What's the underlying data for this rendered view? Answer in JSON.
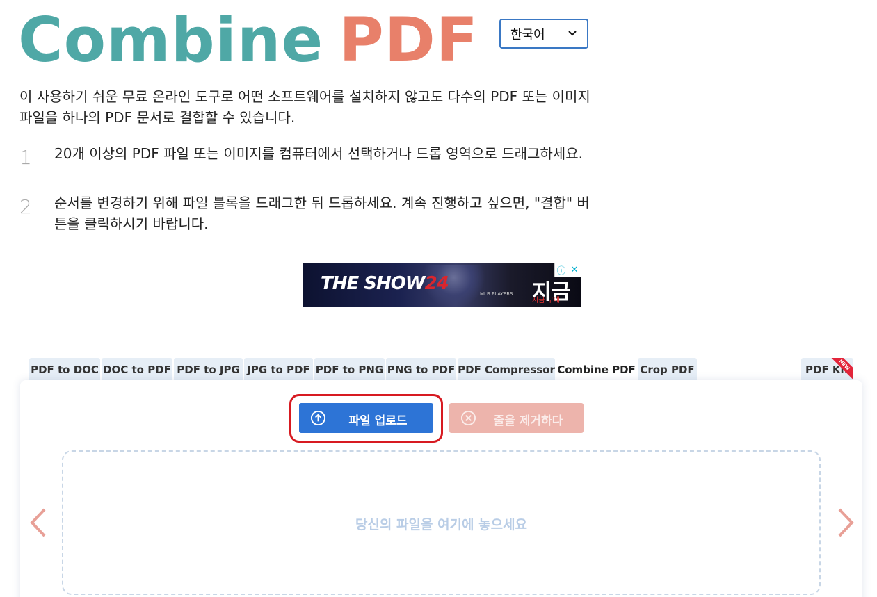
{
  "logo": {
    "part1": "Combine",
    "part2": "PDF"
  },
  "language": {
    "selected": "한국어"
  },
  "intro": "이 사용하기 쉬운 무료 온라인 도구로 어떤 소프트웨어를 설치하지 않고도 다수의 PDF 또는 이미지 파일을 하나의 PDF 문서로 결합할 수 있습니다.",
  "steps": [
    {
      "num": "1",
      "text": "20개 이상의 PDF 파일 또는 이미지를 컴퓨터에서 선택하거나 드롭 영역으로 드래그하세요."
    },
    {
      "num": "2",
      "text": "순서를 변경하기 위해 파일 블록을 드래그한 뒤 드롭하세요. 계속 진행하고 싶으면, \"결합\" 버튼을 클릭하시기 바랍니다."
    }
  ],
  "ad": {
    "title_pre": "THE SHOW",
    "title_num": "24",
    "cta": "지금",
    "sub": "지금 구매",
    "brand": "MLB PLAYERS"
  },
  "tabs": [
    {
      "label": "PDF to DOC"
    },
    {
      "label": "DOC to PDF"
    },
    {
      "label": "PDF to JPG"
    },
    {
      "label": "JPG to PDF"
    },
    {
      "label": "PDF to PNG"
    },
    {
      "label": "PNG to PDF"
    },
    {
      "label": "PDF Compressor"
    },
    {
      "label": "Combine PDF"
    },
    {
      "label": "Crop PDF"
    }
  ],
  "active_tab": "Combine PDF",
  "kit": {
    "label": "PDF Kit",
    "badge": "NEW"
  },
  "buttons": {
    "upload": "파일 업로드",
    "remove": "줄을 제거하다"
  },
  "dropzone": {
    "text": "당신의 파일을 여기에 놓으세요"
  },
  "colors": {
    "logo_teal": "#4fa8a6",
    "logo_coral": "#e8806a",
    "upload_blue": "#2d74d6",
    "remove_pink": "#edb4ac",
    "highlight_red": "#d71a21",
    "arrow": "#e8a097"
  }
}
